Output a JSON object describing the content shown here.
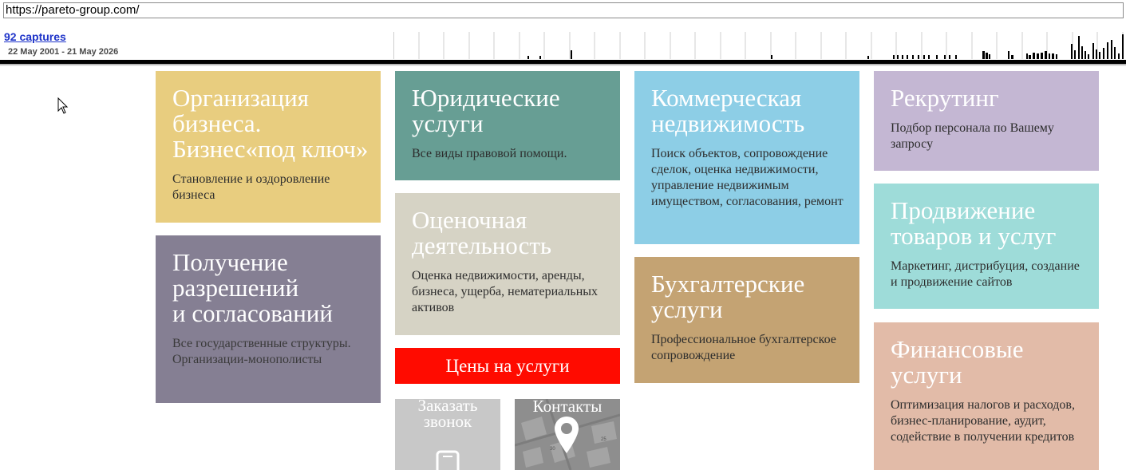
{
  "browser": {
    "url": "https://pareto-group.com/"
  },
  "wayback": {
    "captures_label": "92 captures",
    "date_range": "22 May 2001 - 21 May 2026"
  },
  "tiles": {
    "org": {
      "title_lines": [
        "Организация",
        "бизнеса.",
        "Бизнес«под ключ»"
      ],
      "desc": "Становление и оздоровление бизнеса"
    },
    "permits": {
      "title_lines": [
        "Получение",
        "разрешений",
        "и согласований"
      ],
      "desc": "Все государственные структуры. Организации-монополисты"
    },
    "legal": {
      "title_lines": [
        "Юридические",
        "услуги"
      ],
      "desc": "Все виды правовой помощи."
    },
    "evaluation": {
      "title_lines": [
        "Оценочная",
        "деятельность"
      ],
      "desc": "Оценка недвижимости, аренды, бизнеса, ущерба, нематериальных активов"
    },
    "commercial": {
      "title_lines": [
        "Коммерческая",
        "недвижимость"
      ],
      "desc": "Поиск объектов, сопровождение сделок, оценка недвижимости, управление недвижимым имуществом, согласования, ремонт"
    },
    "accounting": {
      "title_lines": [
        "Бухгалтерские",
        "услуги"
      ],
      "desc": "Профессиональное бухгалтерское сопровождение"
    },
    "recruiting": {
      "title_lines": [
        "Рекрутинг"
      ],
      "desc": "Подбор персонала по Вашему запросу"
    },
    "promotion": {
      "title_lines": [
        "Продвижение",
        "товаров и услуг"
      ],
      "desc": "Маркетинг, дистрибуция, создание и продвижение сайтов"
    },
    "finance": {
      "title_lines": [
        "Финансовые",
        "услуги"
      ],
      "desc": "Оптимизация налогов и расходов, бизнес-планирование, аудит, содействие в получении кредитов"
    }
  },
  "buttons": {
    "prices": "Цены на услуги",
    "call_lines": [
      "Заказать",
      "звонок"
    ],
    "contacts": "Контакты"
  },
  "icons": {
    "call": "phone-icon",
    "contacts": "map-pin-icon"
  },
  "colors": {
    "prices_bg": "#ff0b00",
    "link": "#1f34c9"
  }
}
